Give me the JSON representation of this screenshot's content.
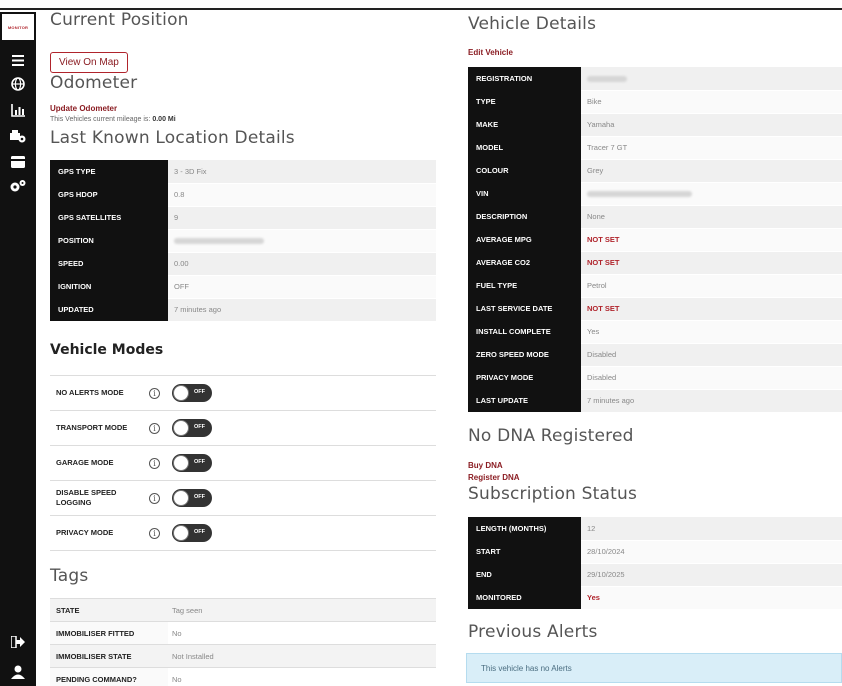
{
  "brand": {
    "label": "MONITOR"
  },
  "sidebar": {
    "items": [
      {
        "icon": "menu-icon",
        "glyph": "≡"
      },
      {
        "icon": "globe-icon",
        "glyph": "🌐"
      },
      {
        "icon": "chart-icon",
        "glyph": "📊"
      },
      {
        "icon": "vehicle-icon",
        "glyph": "🚗"
      },
      {
        "icon": "card-icon",
        "glyph": "▭"
      },
      {
        "icon": "settings-icon",
        "glyph": "⚙"
      }
    ],
    "bottom": [
      {
        "icon": "logout-icon",
        "glyph": "⇥"
      },
      {
        "icon": "user-icon",
        "glyph": "●"
      }
    ]
  },
  "position": {
    "title": "Current Position",
    "view_map": "View On Map"
  },
  "odometer": {
    "title": "Odometer",
    "update_link": "Update Odometer",
    "mileage_prefix": "This Vehicles current mileage is:",
    "mileage_value": "0.00 Mi"
  },
  "location": {
    "title": "Last Known Location Details",
    "rows": [
      {
        "key": "GPS TYPE",
        "value": "3 - 3D Fix"
      },
      {
        "key": "GPS HDOP",
        "value": "0.8"
      },
      {
        "key": "GPS SATELLITES",
        "value": "9"
      },
      {
        "key": "POSITION",
        "value": ""
      },
      {
        "key": "SPEED",
        "value": "0.00"
      },
      {
        "key": "IGNITION",
        "value": "OFF"
      },
      {
        "key": "UPDATED",
        "value": "7 minutes ago"
      }
    ]
  },
  "modes": {
    "title": "Vehicle Modes",
    "toggle_text": "OFF",
    "rows": [
      {
        "label": "NO ALERTS MODE"
      },
      {
        "label": "TRANSPORT MODE"
      },
      {
        "label": "GARAGE MODE"
      },
      {
        "label": "DISABLE SPEED LOGGING"
      },
      {
        "label": "PRIVACY MODE"
      }
    ]
  },
  "tags": {
    "title": "Tags",
    "rows": [
      {
        "key": "STATE",
        "value": "Tag seen"
      },
      {
        "key": "IMMOBILISER FITTED",
        "value": "No"
      },
      {
        "key": "IMMOBILISER STATE",
        "value": "Not Installed"
      },
      {
        "key": "PENDING COMMAND?",
        "value": "No"
      }
    ]
  },
  "vehicle": {
    "title": "Vehicle Details",
    "edit_link": "Edit Vehicle",
    "rows": [
      {
        "key": "REGISTRATION",
        "value": ""
      },
      {
        "key": "TYPE",
        "value": "Bike"
      },
      {
        "key": "MAKE",
        "value": "Yamaha"
      },
      {
        "key": "MODEL",
        "value": "Tracer 7 GT"
      },
      {
        "key": "COLOUR",
        "value": "Grey"
      },
      {
        "key": "VIN",
        "value": ""
      },
      {
        "key": "DESCRIPTION",
        "value": "None"
      },
      {
        "key": "AVERAGE MPG",
        "value": "NOT SET"
      },
      {
        "key": "AVERAGE CO2",
        "value": "NOT SET"
      },
      {
        "key": "FUEL TYPE",
        "value": "Petrol"
      },
      {
        "key": "LAST SERVICE DATE",
        "value": "NOT SET"
      },
      {
        "key": "INSTALL COMPLETE",
        "value": "Yes"
      },
      {
        "key": "ZERO SPEED MODE",
        "value": "Disabled"
      },
      {
        "key": "PRIVACY MODE",
        "value": "Disabled"
      },
      {
        "key": "LAST UPDATE",
        "value": "7 minutes ago"
      }
    ]
  },
  "dna": {
    "title": "No DNA Registered",
    "buy_link": "Buy DNA",
    "register_link": "Register DNA"
  },
  "subscription": {
    "title": "Subscription Status",
    "rows": [
      {
        "key": "LENGTH (MONTHS)",
        "value": "12"
      },
      {
        "key": "START",
        "value": "28/10/2024"
      },
      {
        "key": "END",
        "value": "29/10/2025"
      },
      {
        "key": "MONITORED",
        "value": "Yes"
      }
    ]
  },
  "alerts": {
    "title": "Previous Alerts",
    "empty_text": "This vehicle has no Alerts"
  },
  "colors": {
    "accent": "#8b1d23",
    "sidebar_bg": "#111111",
    "info_bg": "#d9eef8"
  }
}
